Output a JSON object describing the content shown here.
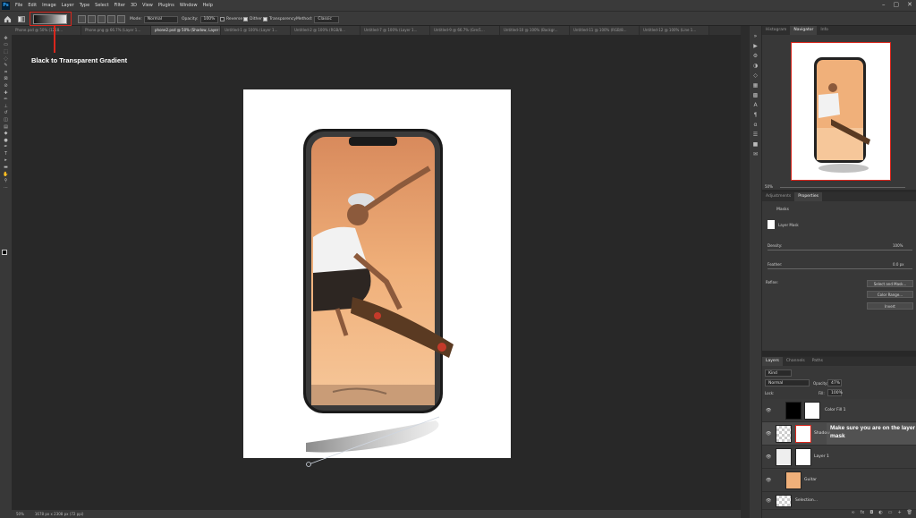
{
  "menubar": {
    "logo": "Ps",
    "items": [
      "File",
      "Edit",
      "Image",
      "Layer",
      "Type",
      "Select",
      "Filter",
      "3D",
      "View",
      "Plugins",
      "Window",
      "Help"
    ],
    "window_controls": [
      "–",
      "▢",
      "✕"
    ]
  },
  "options": {
    "mode_label": "Mode:",
    "mode_value": "Normal",
    "opacity_label": "Opacity:",
    "opacity_value": "100%",
    "reverse": "Reverse",
    "dither": "Dither",
    "transparency": "Transparency",
    "method_label": "Method:",
    "method_value": "Classic"
  },
  "annotations": {
    "gradient_note": "Black to Transparent Gradient",
    "mask_note": "Make sure you are on the layer mask"
  },
  "tabs": [
    {
      "label": "Phone.psd @ 50% (1218...",
      "active": false
    },
    {
      "label": "Phone.png @ 66.7% (Layer 1...",
      "active": false
    },
    {
      "label": "phone2.psd @ 50% (Shadow, Layer Mask/8) *",
      "active": true
    },
    {
      "label": "Untitled-1 @ 100% (Layer 1...",
      "active": false
    },
    {
      "label": "Untitled-2 @ 100% (RGB/8...",
      "active": false
    },
    {
      "label": "Untitled-7 @ 100% (Layer 1...",
      "active": false
    },
    {
      "label": "Untitled-9 @ 66.7% (Gre/1...",
      "active": false
    },
    {
      "label": "Untitled-10 @ 100% (Backgr...",
      "active": false
    },
    {
      "label": "Untitled-11 @ 100% (RGB/8...",
      "active": false
    },
    {
      "label": "Untitled-12 @ 100% (Line 1...",
      "active": false
    }
  ],
  "status": {
    "zoom": "50%",
    "doc_size": "1678 px x 2308 px (72 ppi)"
  },
  "navigator": {
    "tabs": [
      "Histogram",
      "Navigator",
      "Info"
    ],
    "active": "Navigator",
    "zoom": "50%"
  },
  "properties": {
    "tabs": [
      "Adjustments",
      "Properties"
    ],
    "active": "Properties",
    "header": "Masks",
    "mask_label": "Layer Mask",
    "density_label": "Density:",
    "density_value": "100%",
    "feather_label": "Feather:",
    "feather_value": "0.0 px",
    "refine_label": "Refine:",
    "buttons": [
      "Select and Mask...",
      "Color Range...",
      "Invert"
    ]
  },
  "layers": {
    "tabs": [
      "Layers",
      "Channels",
      "Paths"
    ],
    "active": "Layers",
    "kind": "Kind",
    "blend": "Normal",
    "opacity_label": "Opacity:",
    "opacity_value": "47%",
    "lock_label": "Lock:",
    "fill_label": "Fill:",
    "fill_value": "100%",
    "rows": [
      {
        "name": "Color Fill 1"
      },
      {
        "name": "Shadow"
      },
      {
        "name": "Layer 1"
      },
      {
        "name": "Guitar"
      },
      {
        "name": "Selection..."
      }
    ]
  },
  "colors": {
    "accent": "#d9261c",
    "ui_dark": "#282828",
    "panel": "#383838"
  }
}
